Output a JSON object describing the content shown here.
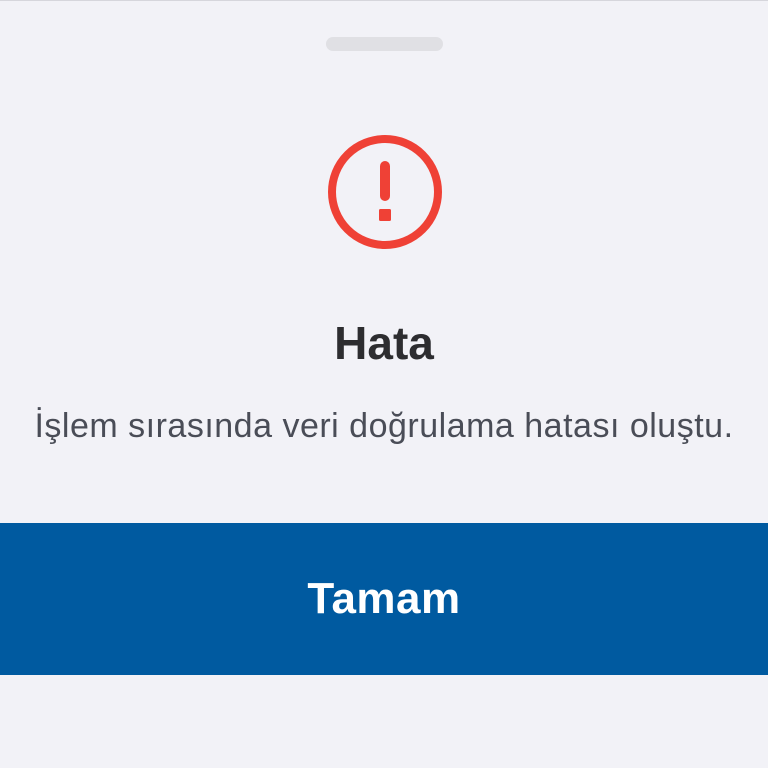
{
  "dialog": {
    "icon": "alert-circle-icon",
    "icon_color": "#ef4136",
    "title": "Hata",
    "message": "İşlem sırasında veri doğrulama hatası oluştu.",
    "confirm_label": "Tamam",
    "confirm_color": "#005aa0"
  }
}
